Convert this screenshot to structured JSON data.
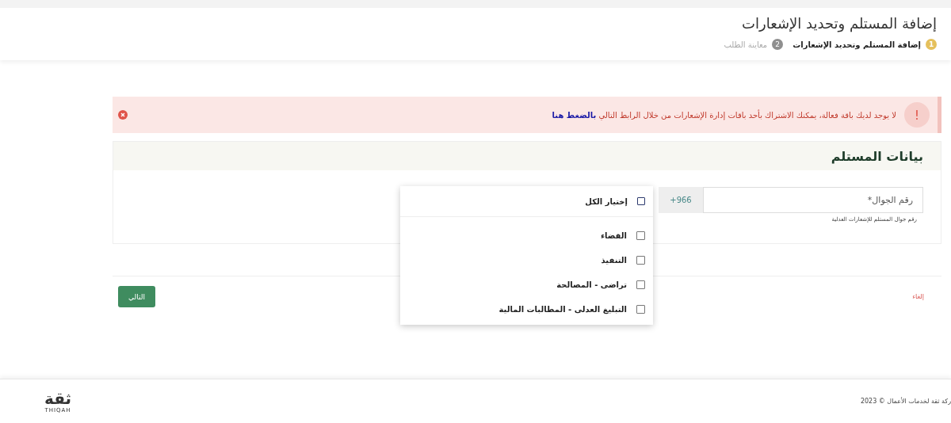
{
  "header": {
    "title": "إضافة المستلم وتحديد الإشعارات",
    "steps": [
      {
        "number": "1",
        "label": "إضافة المستلم وتحديد الإشعارات",
        "active": true
      },
      {
        "number": "2",
        "label": "معاينة الطلب",
        "active": false
      }
    ]
  },
  "alert": {
    "icon": "!",
    "message": "لا يوجد لديك باقة فعالة، يمكنك الاشتراك بأحد باقات إدارة الإشعارات من خلال الرابط التالي",
    "link": "بالضغط هنا"
  },
  "card": {
    "title": "بيانات المستلم",
    "phone": {
      "placeholder": "رقم الجوال*",
      "prefix": "+966",
      "hint": "رقم جوال المستلم للإشعارات العدلية"
    }
  },
  "dropdown": {
    "select_all": {
      "label": "إختيار الكل",
      "checked": false
    },
    "options": [
      {
        "label": "القضاء",
        "checked": false
      },
      {
        "label": "التنفيذ",
        "checked": false
      },
      {
        "label": "تراضى - المصالحة",
        "checked": false
      },
      {
        "label": "التبليغ العدلى - المطالبات المالية",
        "checked": false
      }
    ]
  },
  "actions": {
    "cancel": "إلغاء",
    "next": "التالي"
  },
  "footer": {
    "logo": "ثقة",
    "logo_sub": "THIQAH",
    "copyright": "ركة ثقة لخدمات الأعمال © 2023"
  }
}
